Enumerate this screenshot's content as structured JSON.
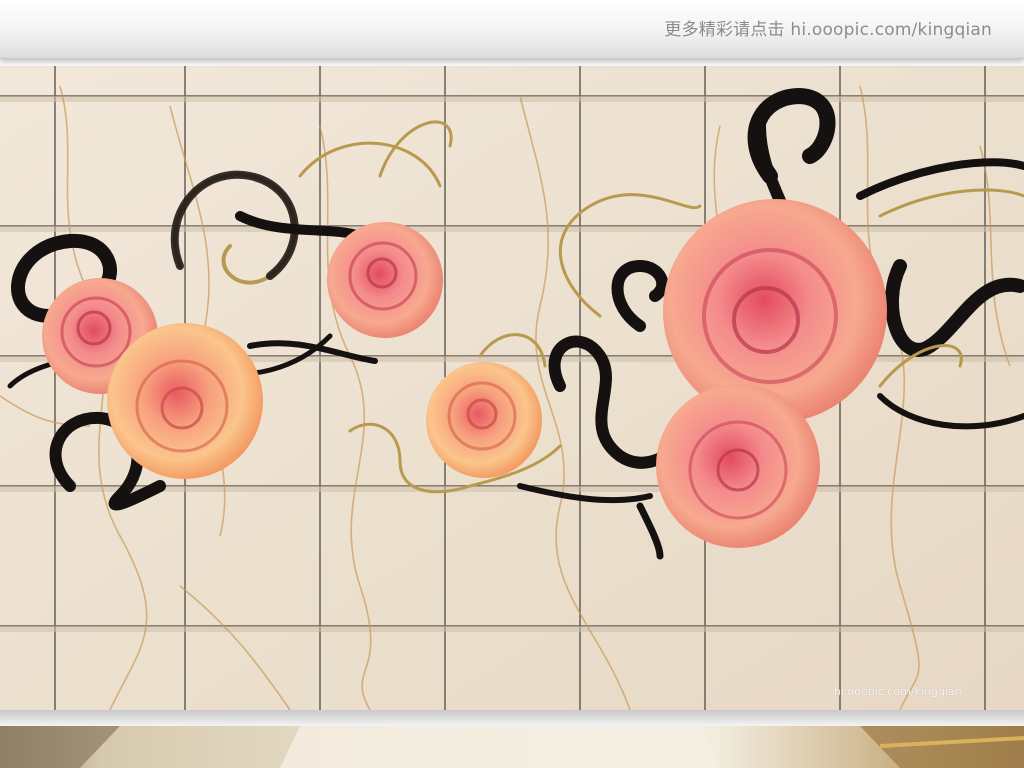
{
  "header": {
    "watermark": "更多精彩请点击 hi.ooopic.com/kingqian"
  },
  "artwork": {
    "watermark": "hi.ooopic.com/kingqian",
    "colors": {
      "marble": "#eee3d3",
      "grout": "#3a332c",
      "vein": "#c99a58",
      "swirl_black": "#141110",
      "swirl_gold": "#b89a4e",
      "rose_pink": "#f27c86",
      "rose_peach": "#f5a36a"
    }
  }
}
